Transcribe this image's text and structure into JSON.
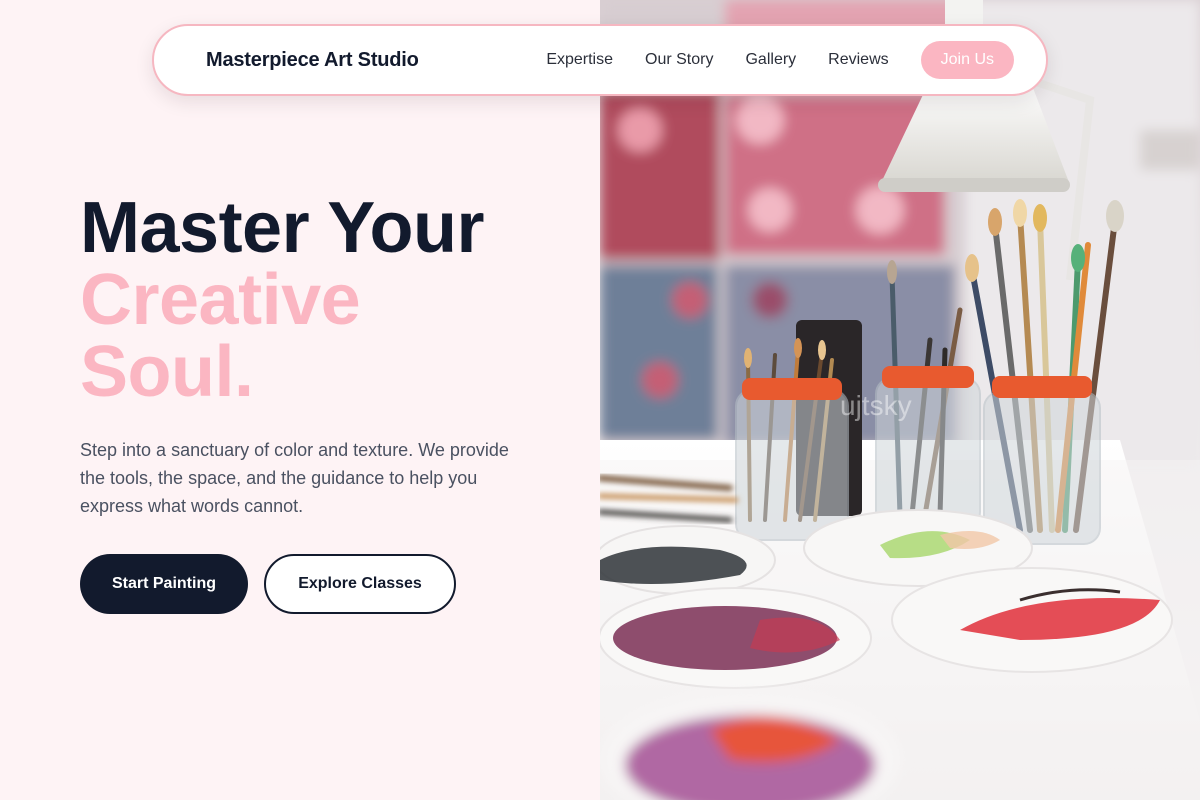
{
  "nav": {
    "brand": "Masterpiece Art Studio",
    "links": [
      "Expertise",
      "Our Story",
      "Gallery",
      "Reviews"
    ],
    "cta": "Join Us"
  },
  "hero": {
    "line1": "Master Your",
    "line2": "Creative",
    "line3": "Soul.",
    "description": "Step into a sanctuary of color and texture. We provide the tools, the space, and the guidance to help you express what words cannot.",
    "primary_cta": "Start Painting",
    "secondary_cta": "Explore Classes"
  },
  "image": {
    "subject": "paint brushes in jars with paint palettes on an art studio table",
    "watermark": "ujtsky"
  },
  "colors": {
    "accent": "#fbb6c2",
    "dark": "#121a2d",
    "background": "#fef3f5",
    "nav_border": "#f6b7c1"
  }
}
